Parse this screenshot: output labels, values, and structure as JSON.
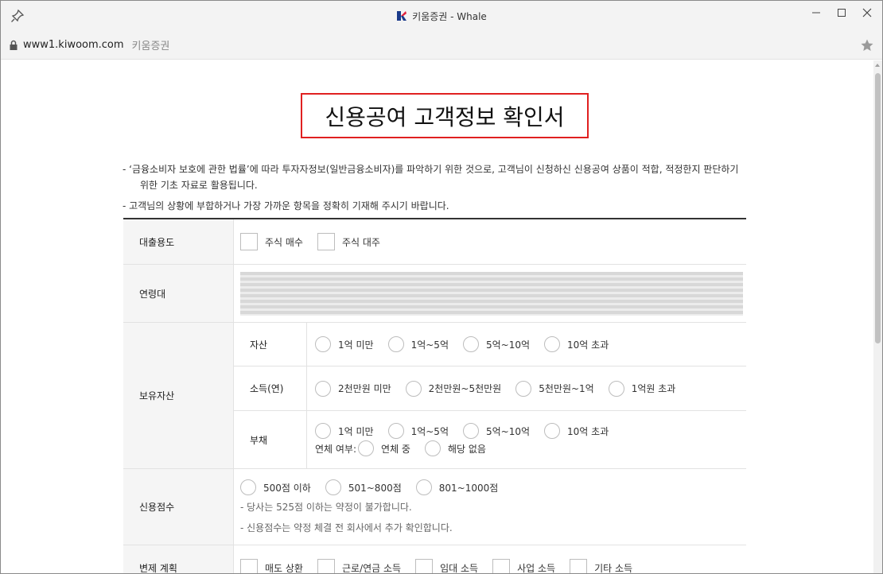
{
  "window": {
    "title": "키움증권 - Whale",
    "url": "www1.kiwoom.com",
    "site_name": "키움증권"
  },
  "colors": {
    "accent_border": "#e02020",
    "logo_blue": "#1a3a8a",
    "logo_red": "#e0203a"
  },
  "icons": [
    "pin-icon",
    "kiwoom-logo-icon",
    "minimize-icon",
    "maximize-icon",
    "close-icon",
    "lock-icon",
    "star-icon"
  ],
  "document": {
    "title": "신용공여 고객정보 확인서",
    "notes": [
      "- ‘금융소비자 보호에 관한 법률’에 따라 투자자정보(일반금융소비자)를 파악하기 위한 것으로, 고객님이 신청하신 신용공여 상품이 적합, 적정한지 판단하기",
      "위한 기초 자료로 활용됩니다.",
      "- 고객님의 상황에 부합하거나 가장 가까운 항목을 정확히 기재해 주시기 바랍니다."
    ]
  },
  "form": {
    "loan_purpose": {
      "label": "대출용도",
      "options": [
        "주식 매수",
        "주식 대주"
      ]
    },
    "age_group": {
      "label": "연령대"
    },
    "assets": {
      "label": "보유자산",
      "asset": {
        "label": "자산",
        "options": [
          "1억 미만",
          "1억~5억",
          "5억~10억",
          "10억 초과"
        ]
      },
      "income": {
        "label": "소득(연)",
        "options": [
          "2천만원 미만",
          "2천만원~5천만원",
          "5천만원~1억",
          "1억원 초과"
        ]
      },
      "debt": {
        "label": "부채",
        "options": [
          "1억 미만",
          "1억~5억",
          "5억~10억",
          "10억 초과"
        ],
        "overdue_label": "연체 여부:",
        "overdue_options": [
          "연체 중",
          "해당 없음"
        ]
      }
    },
    "credit_score": {
      "label": "신용점수",
      "options": [
        "500점 이하",
        "501~800점",
        "801~1000점"
      ],
      "notes": [
        "- 당사는 525점 이하는 약정이 불가합니다.",
        "- 신용점수는 약정 체결 전 회사에서 추가 확인합니다."
      ]
    },
    "repayment": {
      "label": "변제 계획",
      "options": [
        "매도 상환",
        "근로/연금 소득",
        "임대 소득",
        "사업 소득",
        "기타 소득"
      ]
    }
  }
}
